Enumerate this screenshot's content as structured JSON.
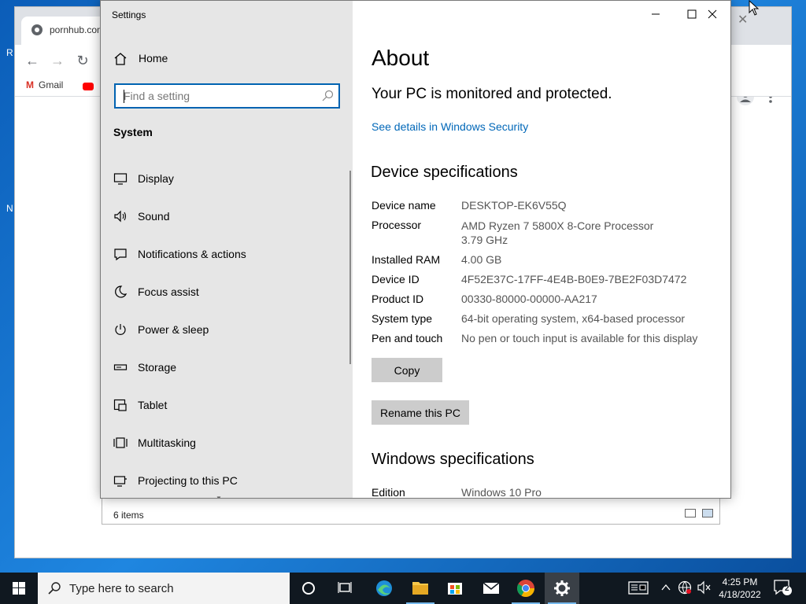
{
  "colors": {
    "accent": "#0063b1",
    "link": "#0067b8",
    "taskbar": "#101820",
    "sidebar_bg": "#e6e6e6"
  },
  "chrome": {
    "tab_title": "pornhub.com",
    "bookmarks": {
      "gmail": "Gmail"
    }
  },
  "explorer": {
    "status": "6 items"
  },
  "settings": {
    "title": "Settings",
    "home_label": "Home",
    "search_placeholder": "Find a setting",
    "section": "System",
    "nav_items": [
      {
        "label": "Display",
        "icon": "display-icon"
      },
      {
        "label": "Sound",
        "icon": "sound-icon"
      },
      {
        "label": "Notifications & actions",
        "icon": "notifications-icon"
      },
      {
        "label": "Focus assist",
        "icon": "moon-icon"
      },
      {
        "label": "Power & sleep",
        "icon": "power-icon"
      },
      {
        "label": "Storage",
        "icon": "storage-icon"
      },
      {
        "label": "Tablet",
        "icon": "tablet-icon"
      },
      {
        "label": "Multitasking",
        "icon": "multitasking-icon"
      },
      {
        "label": "Projecting to this PC",
        "icon": "projector-icon"
      }
    ],
    "content": {
      "heading": "About",
      "protection_text": "Your PC is monitored and protected.",
      "security_link": "See details in Windows Security",
      "device_specs_heading": "Device specifications",
      "specs": {
        "device_name": {
          "label": "Device name",
          "value": "DESKTOP-EK6V55Q"
        },
        "processor": {
          "label": "Processor",
          "value": "AMD Ryzen 7 5800X 8-Core Processor",
          "value2": "3.79 GHz"
        },
        "ram": {
          "label": "Installed RAM",
          "value": "4.00 GB"
        },
        "device_id": {
          "label": "Device ID",
          "value": "4F52E37C-17FF-4E4B-B0E9-7BE2F03D7472"
        },
        "product_id": {
          "label": "Product ID",
          "value": "00330-80000-00000-AA217"
        },
        "system_type": {
          "label": "System type",
          "value": "64-bit operating system, x64-based processor"
        },
        "pen_touch": {
          "label": "Pen and touch",
          "value": "No pen or touch input is available for this display"
        }
      },
      "copy_button": "Copy",
      "rename_button": "Rename this PC",
      "windows_specs_heading": "Windows specifications",
      "edition": {
        "label": "Edition",
        "value": "Windows 10 Pro"
      }
    }
  },
  "taskbar": {
    "search_placeholder": "Type here to search",
    "time": "4:25 PM",
    "date": "4/18/2022",
    "notification_count": "2"
  }
}
